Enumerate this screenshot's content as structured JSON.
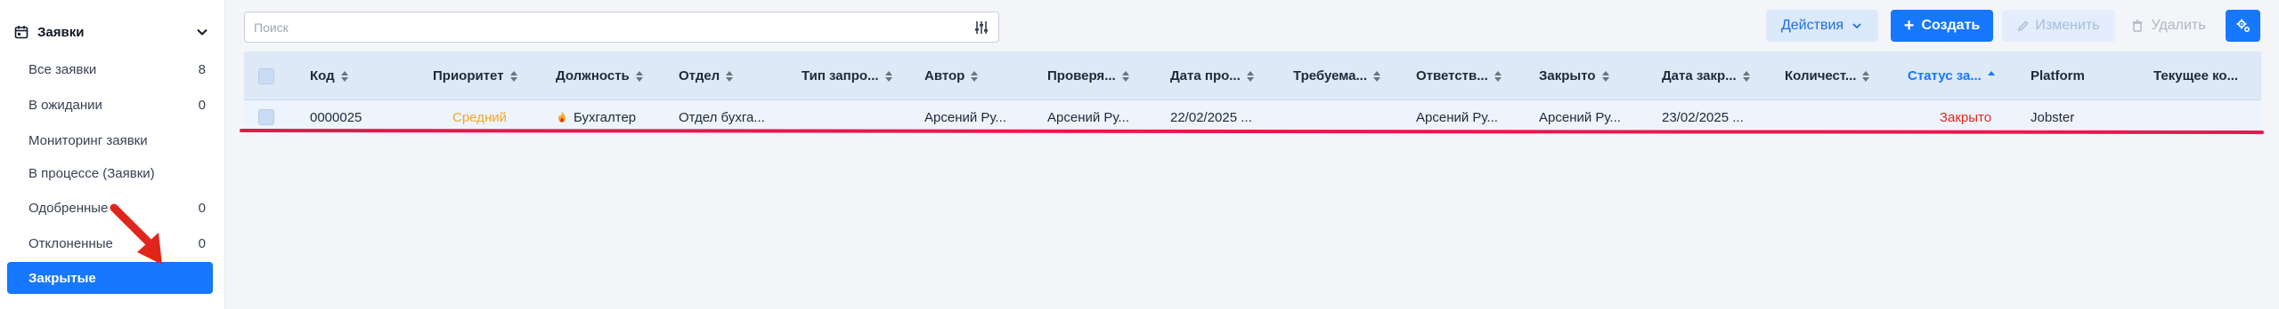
{
  "sidebar": {
    "header": {
      "title": "Заявки",
      "icon": "calendar-icon"
    },
    "items": [
      {
        "label": "Все заявки",
        "count": "8"
      },
      {
        "label": "В ожидании",
        "count": "0"
      },
      {
        "label": "Мониторинг заявки",
        "count": ""
      },
      {
        "label": "В процессе (Заявки)",
        "count": ""
      },
      {
        "label": "Одобренные",
        "count": "0"
      },
      {
        "label": "Отклоненные",
        "count": "0"
      },
      {
        "label": "Закрытые",
        "count": "",
        "active": true
      }
    ]
  },
  "search": {
    "placeholder": "Поиск",
    "value": ""
  },
  "toolbar": {
    "actions_label": "Действия",
    "create_label": "Создать",
    "edit_label": "Изменить",
    "delete_label": "Удалить"
  },
  "table": {
    "columns": [
      "Код",
      "Приоритет",
      "Должность",
      "Отдел",
      "Тип запро...",
      "Автор",
      "Проверя...",
      "Дата про...",
      "Требуема...",
      "Ответств...",
      "Закрыто",
      "Дата закр...",
      "Количест...",
      "Статус за...",
      "Platform",
      "Текущее ко..."
    ],
    "sorted_column": "Статус за...",
    "rows": [
      {
        "code": "0000025",
        "priority": "Средний",
        "position": "Бухгалтер",
        "department": "Отдел бухга...",
        "request_type": "",
        "author": "Арсений Ру...",
        "checker": "Арсений Ру...",
        "date_pro": "22/02/2025 ...",
        "required": "",
        "responsible": "Арсений Ру...",
        "closed_by": "Арсений Ру...",
        "date_closed": "23/02/2025 ...",
        "quantity": "",
        "status": "Закрыто",
        "platform": "Jobster",
        "current": ""
      }
    ]
  },
  "colors": {
    "accent": "#1677ff",
    "priority_medium": "#f5a623",
    "status_closed": "#e0261c",
    "annotation_red": "#e8174a"
  }
}
